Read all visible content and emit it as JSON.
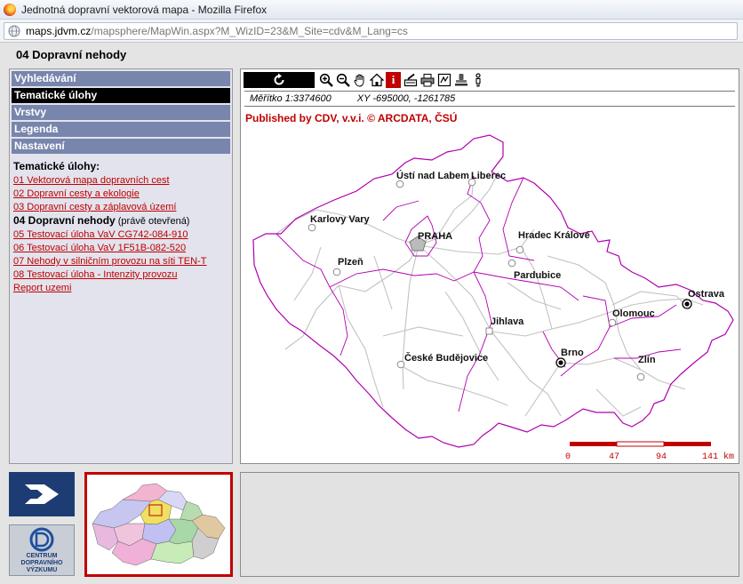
{
  "browser": {
    "window_title": "Jednotná dopravní vektorová mapa - Mozilla Firefox",
    "url_domain": "maps.jdvm.cz",
    "url_path": "/mapsphere/MapWin.aspx?M_WizID=23&M_Site=cdv&M_Lang=cs"
  },
  "page": {
    "title": "04 Dopravní nehody"
  },
  "sidebar": {
    "menu": [
      {
        "label": "Vyhledávání"
      },
      {
        "label": "Tematické úlohy",
        "active": true
      },
      {
        "label": "Vrstvy"
      },
      {
        "label": "Legenda"
      },
      {
        "label": "Nastavení"
      }
    ],
    "tasks_heading": "Tematické úlohy:",
    "tasks": [
      "01 Vektorová mapa dopravních cest",
      "02 Dopravní cesty a ekologie",
      "03 Dopravní cesty a záplavová území"
    ],
    "current_task": "04 Dopravní nehody",
    "current_note": "(právě otevřená)",
    "tasks_after": [
      "05 Testovací úloha VaV CG742-084-910",
      "06 Testovací úloha VaV 1F51B-082-520",
      "07 Nehody v silničním provozu na síti TEN-T",
      "08 Testovací úloha - Intenzity provozu",
      "Report uzemi"
    ]
  },
  "toolbar": {
    "tools": [
      "refresh-icon",
      "zoom-in-icon",
      "zoom-out-icon",
      "pan-hand-icon",
      "home-icon",
      "info-icon",
      "edit-icon",
      "print-icon",
      "measure-icon",
      "stamp-icon",
      "person-icon"
    ],
    "info_glyph": "i"
  },
  "map": {
    "scale_text": "Měřítko 1:3374600",
    "coords_text": "XY -695000, -1261785",
    "published": "Published by CDV, v.v.i.  © ARCDATA, ČSÚ",
    "cities": [
      "Ústí nad Labem",
      "Liberec",
      "Karlovy Vary",
      "PRAHA",
      "Hradec Králové",
      "Plzeň",
      "Pardubice",
      "Ostrava",
      "Olomouc",
      "Jihlava",
      "Brno",
      "České Budějovice",
      "Zlín"
    ],
    "scale_bar_labels": [
      "0",
      "47",
      "94",
      "141 km"
    ]
  },
  "colors": {
    "menu_bg": "#7885ad",
    "menu_active": "#000000",
    "accent_red": "#c00000",
    "border_magenta": "#b000b0",
    "road_gray": "#c0c0c0"
  },
  "logos": {
    "cdv_text": [
      "CENTRUM",
      "DOPRAVNÍHO",
      "VÝZKUMU"
    ]
  }
}
